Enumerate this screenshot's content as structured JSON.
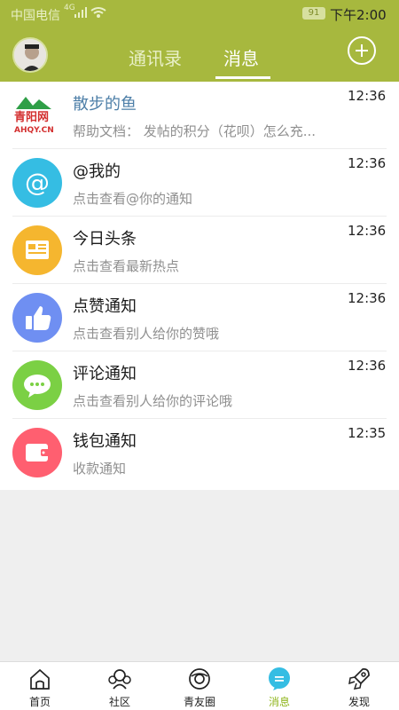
{
  "status": {
    "carrier": "中国电信",
    "network": "4G",
    "battery": "91",
    "time": "下午2:00"
  },
  "tabs": {
    "contacts": "通讯录",
    "messages": "消息"
  },
  "messages": [
    {
      "title": "散步的鱼",
      "subtitle": "帮助文档： 发帖的积分（花呗）怎么充...",
      "time": "12:36",
      "icon": "qingyang-logo",
      "logo_text_top": "青阳网",
      "logo_text_bottom": "AHQY.CN",
      "color": "#d32f2f"
    },
    {
      "title": "@我的",
      "subtitle": "点击查看@你的通知",
      "time": "12:36",
      "icon": "at-icon",
      "color": "#35bde3"
    },
    {
      "title": "今日头条",
      "subtitle": "点击查看最新热点",
      "time": "12:36",
      "icon": "newspaper-icon",
      "color": "#f5b62f"
    },
    {
      "title": "点赞通知",
      "subtitle": "点击查看别人给你的赞哦",
      "time": "12:36",
      "icon": "thumbs-up-icon",
      "color": "#6f8ff2"
    },
    {
      "title": "评论通知",
      "subtitle": "点击查看别人给你的评论哦",
      "time": "12:36",
      "icon": "comment-icon",
      "color": "#7bd044"
    },
    {
      "title": "钱包通知",
      "subtitle": "收款通知",
      "time": "12:35",
      "icon": "wallet-icon",
      "color": "#ff5f70"
    }
  ],
  "bottom_nav": [
    {
      "label": "首页",
      "icon": "home-icon"
    },
    {
      "label": "社区",
      "icon": "community-icon"
    },
    {
      "label": "青友圈",
      "icon": "moments-icon"
    },
    {
      "label": "消息",
      "icon": "message-icon",
      "active": true
    },
    {
      "label": "发现",
      "icon": "rocket-icon"
    }
  ],
  "colors": {
    "header": "#a7b83e",
    "active_nav": "#8fb51c"
  }
}
